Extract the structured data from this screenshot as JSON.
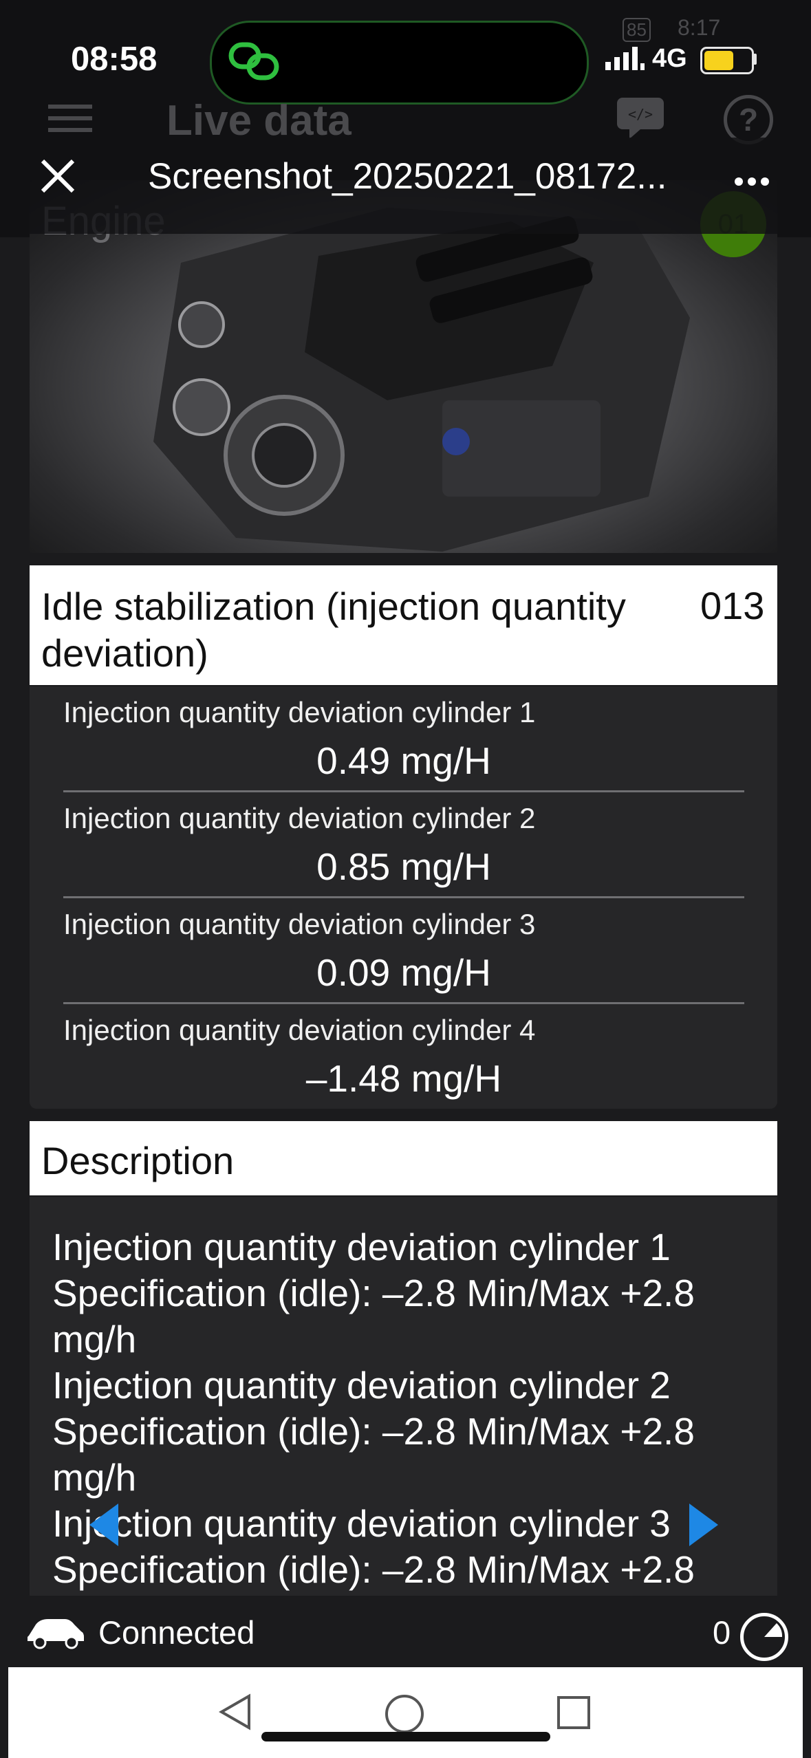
{
  "status_bar": {
    "time": "08:58",
    "network": "4G",
    "underlying_time": "8:17",
    "underlying_battery": "85"
  },
  "app_bar": {
    "title": "Live data"
  },
  "viewer": {
    "file_name": "Screenshot_20250221_08172..."
  },
  "engine": {
    "label": "Engine",
    "badge": "01"
  },
  "group": {
    "title": "Idle stabilization (injection quantity deviation)",
    "code": "013"
  },
  "values": [
    {
      "label": "Injection quantity deviation cylinder 1",
      "value": "0.49 mg/H"
    },
    {
      "label": "Injection quantity deviation cylinder 2",
      "value": "0.85 mg/H"
    },
    {
      "label": "Injection quantity deviation cylinder 3",
      "value": "0.09 mg/H"
    },
    {
      "label": "Injection quantity deviation cylinder 4",
      "value": "–1.48 mg/H"
    }
  ],
  "description": {
    "title": "Description",
    "text": "Injection quantity deviation cylinder 1\n Specification (idle): –2.8 Min/Max +2.8 mg/h\nInjection quantity deviation cylinder 2\n Specification (idle): –2.8 Min/Max +2.8 mg/h\nInjection quantity deviation cylinder 3\n Specification (idle): –2.8 Min/Max +2.8"
  },
  "footer": {
    "status": "Connected",
    "count": "0"
  },
  "icons": {
    "accent_green": "#2fbf3f",
    "nav_arrow_blue": "#1e88e5"
  }
}
